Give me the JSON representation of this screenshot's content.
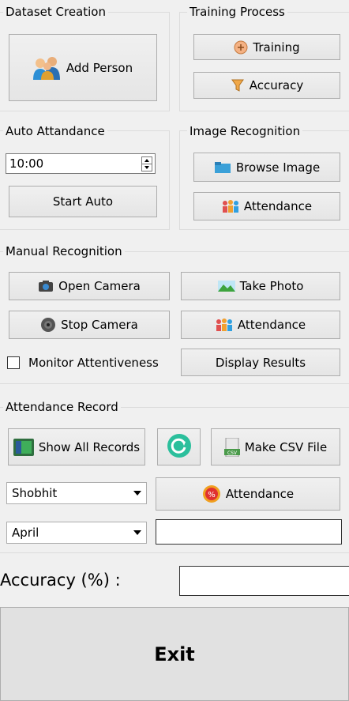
{
  "dataset": {
    "title": "Dataset Creation",
    "add_person": "Add Person"
  },
  "training": {
    "title": "Training Process",
    "training": "Training",
    "accuracy": "Accuracy"
  },
  "auto": {
    "title": "Auto Attandance",
    "time_value": "10:00",
    "start": "Start Auto"
  },
  "image": {
    "title": "Image Recognition",
    "browse": "Browse Image",
    "attendance": "Attendance"
  },
  "manual": {
    "title": "Manual Recognition",
    "open_camera": "Open Camera",
    "take_photo": "Take Photo",
    "stop_camera": "Stop Camera",
    "attendance": "Attendance",
    "monitor": "Monitor Attentiveness",
    "display_results": "Display Results"
  },
  "record": {
    "title": "Attendance Record",
    "show_all": "Show All Records",
    "make_csv": "Make CSV File",
    "name_select": "Shobhit",
    "attendance": "Attendance",
    "month_select": "April",
    "result_value": ""
  },
  "accuracy_label": "Accuracy (%) :",
  "accuracy_value": "",
  "exit": "Exit"
}
